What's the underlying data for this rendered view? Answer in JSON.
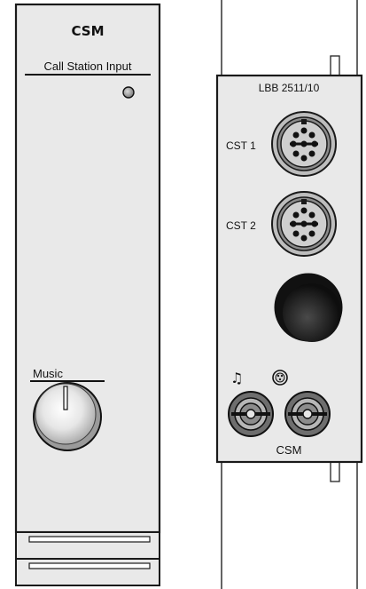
{
  "front_panel": {
    "title": "CSM",
    "section_label": "Call Station Input",
    "knob_label": "Music"
  },
  "rear_panel": {
    "model": "LBB 2511/10",
    "connectors": [
      {
        "label": "CST 1"
      },
      {
        "label": "CST 2"
      }
    ],
    "bottom_label": "CSM",
    "icons": [
      "music-note-icon",
      "din-socket-icon"
    ]
  }
}
